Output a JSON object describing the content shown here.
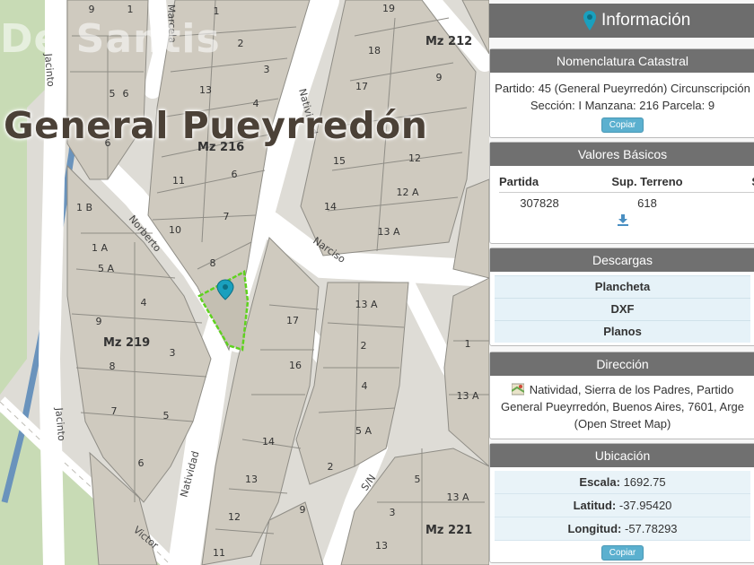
{
  "map": {
    "watermark": "De Santis",
    "title": "General Pueyrredón",
    "manzanas": [
      "Mz 212",
      "Mz 216",
      "Mz 219",
      "Mz 221"
    ],
    "streets": [
      "Jacinto",
      "Marcela",
      "Natividad",
      "Norberto",
      "Narciso",
      "Jacinto",
      "Natividad",
      "Victor",
      "S/N"
    ],
    "lots": [
      "1",
      "19",
      "18",
      "17",
      "16",
      "15",
      "14",
      "13",
      "12",
      "11",
      "10",
      "9",
      "8",
      "7",
      "6",
      "5",
      "4",
      "3",
      "2",
      "12 A",
      "13 A",
      "1 B",
      "1 A",
      "5 A"
    ],
    "selected_parcel": "9",
    "colors": {
      "parcel": "#cdc8bc",
      "parcel_border": "#8f8d86",
      "street": "#ffffff",
      "background": "#dedcd6",
      "park": "#c7dcb4",
      "rail": "#6a93bc",
      "selected_border": "#5fd21f",
      "pin": "#1aa0be"
    }
  },
  "panel": {
    "header": "Información",
    "nomenclatura": {
      "title": "Nomenclatura Catastral",
      "line1": "Partido: 45 (General Pueyrredón) Circunscripción",
      "line2": "Sección: I Manzana: 216 Parcela: 9",
      "copy_label": "Copiar"
    },
    "valores": {
      "title": "Valores Básicos",
      "headers": [
        "Partida",
        "Sup. Terreno",
        "S"
      ],
      "values": [
        "307828",
        "618"
      ],
      "download_icon": "download-icon"
    },
    "descargas": {
      "title": "Descargas",
      "items": [
        "Plancheta",
        "DXF",
        "Planos"
      ]
    },
    "direccion": {
      "title": "Dirección",
      "line1": "Natividad, Sierra de los Padres, Partido",
      "line2": "General Pueyrredón, Buenos Aires, 7601, Arge",
      "line3": "(Open Street Map)"
    },
    "ubicacion": {
      "title": "Ubicación",
      "escala_label": "Escala:",
      "escala_value": "1692.75",
      "latitud_label": "Latitud:",
      "latitud_value": "-37.95420",
      "longitud_label": "Longitud:",
      "longitud_value": "-57.78293",
      "copy_label": "Copiar"
    }
  }
}
